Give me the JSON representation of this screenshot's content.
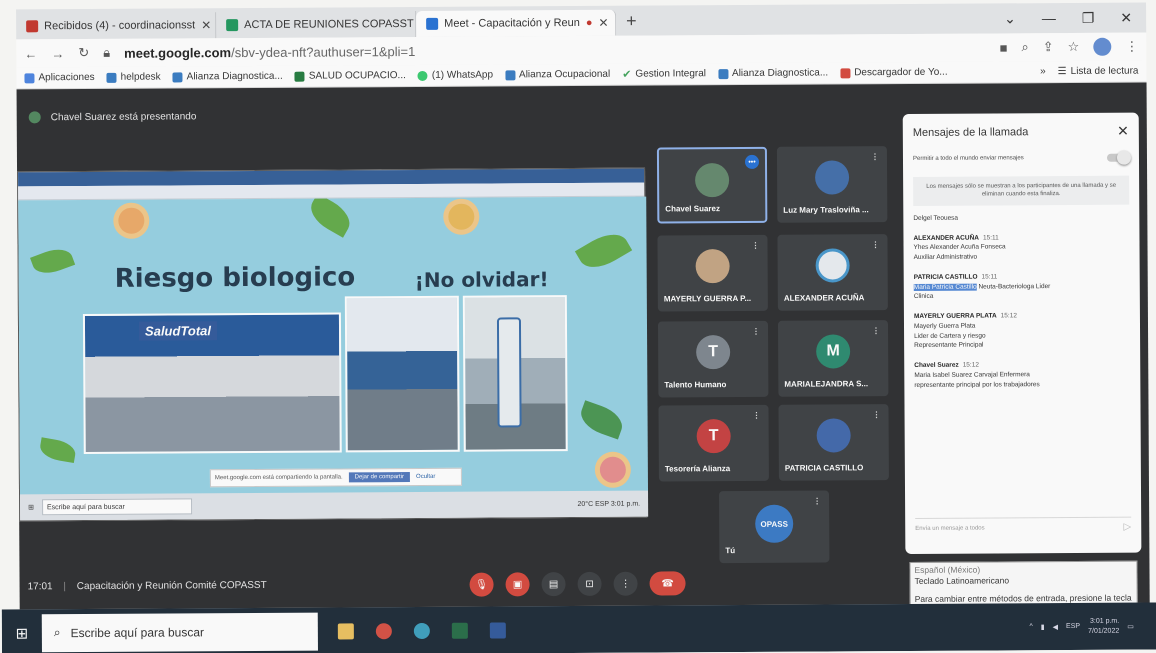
{
  "browser": {
    "tabs": [
      {
        "title": "Recibidos (4) - coordinacionsst",
        "color": "#d93025"
      },
      {
        "title": "ACTA DE REUNIONES COPASST",
        "color": "#0f9d58"
      },
      {
        "title": "Meet - Capacitación y Reun",
        "color": "#1a73e8",
        "active": true
      }
    ],
    "new_tab": "+",
    "url_host": "meet.google.com",
    "url_path": "/sbv-ydea-nft?authuser=1&pli=1",
    "bookmarks": [
      {
        "label": "Aplicaciones",
        "color": "#4285f4"
      },
      {
        "label": "helpdesk",
        "color": "#2d7dd2"
      },
      {
        "label": "Alianza Diagnostica...",
        "color": "#2d7dd2"
      },
      {
        "label": "SALUD OCUPACIO...",
        "color": "#188038"
      },
      {
        "label": "(1) WhatsApp",
        "color": "#25d366"
      },
      {
        "label": "Alianza Ocupacional",
        "color": "#2d7dd2"
      },
      {
        "label": "Gestion Integral",
        "color": "#34a853"
      },
      {
        "label": "Alianza Diagnostica...",
        "color": "#2d7dd2"
      },
      {
        "label": "Descargador de Yo...",
        "color": "#ea4335"
      }
    ],
    "bookmarks_more": "»",
    "reading_list": "Lista de lectura"
  },
  "meet": {
    "presenter_text": "Chavel Suarez está presentando",
    "slide": {
      "title": "Riesgo biologico",
      "subtitle": "¡No olvidar!",
      "logo_text": "SaludTotal"
    },
    "share_notice": {
      "text": "Meet.google.com está compartiendo la pantalla.",
      "stop": "Dejar de compartir",
      "hide": "Ocultar"
    },
    "inner_search": "Escribe aquí para buscar",
    "inner_tray": "20°C ESP 3:01 p.m.",
    "participants": [
      {
        "name": "Chavel Suarez",
        "initial": "",
        "color": "#5f8a6a",
        "speaking": true
      },
      {
        "name": "Luz Mary Trasloviña ...",
        "initial": "",
        "color": "#3b6fb6"
      },
      {
        "name": "MAYERLY GUERRA P...",
        "initial": "",
        "color": "#c9a47d"
      },
      {
        "name": "ALEXANDER ACUÑA",
        "initial": "",
        "color": "#e9eef3"
      },
      {
        "name": "Talento Humano",
        "initial": "T",
        "color": "#7c8791"
      },
      {
        "name": "MARIALEJANDRA S...",
        "initial": "M",
        "color": "#1e8e6e"
      },
      {
        "name": "Tesorería Alianza",
        "initial": "T",
        "color": "#d93b3b"
      },
      {
        "name": "PATRICIA CASTILLO",
        "initial": "",
        "color": "#3b68b8"
      },
      {
        "name": "Tú",
        "initial": "OPASS",
        "color": "#2e7bd6"
      }
    ],
    "chat": {
      "title": "Mensajes de la llamada",
      "toggle_label": "Permitir a todo el mundo enviar mensajes",
      "info": "Los mensajes sólo se muestran a los participantes de una llamada y se eliminan cuando esta finaliza.",
      "messages": [
        {
          "sender": "",
          "time": "",
          "lines": [
            "Delgel Teouesa"
          ]
        },
        {
          "sender": "ALEXANDER ACUÑA",
          "time": "15:11",
          "lines": [
            "Yhes Alexander Acuña Fonseca",
            "Auxiliar Administrativo"
          ]
        },
        {
          "sender": "PATRICIA CASTILLO",
          "time": "15:11",
          "highlight": "Maria Patricia Castillo",
          "lines": [
            " Neuta-Bacteriologa Lider",
            "Clinica"
          ]
        },
        {
          "sender": "MAYERLY GUERRA PLATA",
          "time": "15:12",
          "lines": [
            "Mayerly Guerra Plata",
            "Lider de Cartera y riesgo",
            "Representante Principal"
          ]
        },
        {
          "sender": "Chavel Suarez",
          "time": "15:12",
          "lines": [
            "Maria Isabel Suarez Carvajal Enfermera",
            "representante principal por los trabajadores"
          ]
        }
      ],
      "input_placeholder": "Envía un mensaje a todos"
    },
    "meeting_time": "17:01",
    "meeting_title": "Capacitación y Reunión Comité COPASST"
  },
  "ime_popup": {
    "lang": "Español (México)",
    "layout": "Teclado Latinoamericano",
    "hint": "Para cambiar entre métodos de entrada, presione la tecla Windows+ Espacio."
  },
  "taskbar": {
    "search_placeholder": "Escribe aquí para buscar",
    "clock": "3:01 p.m.",
    "date": "7/01/2022",
    "lang": "ESP"
  }
}
